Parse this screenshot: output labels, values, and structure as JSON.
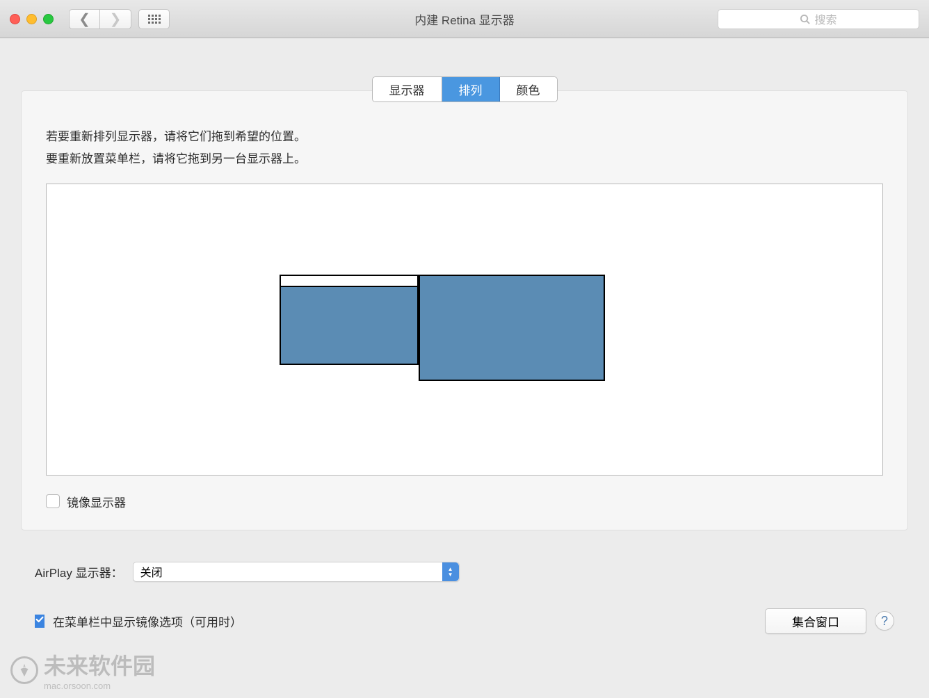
{
  "window": {
    "title": "内建 Retina 显示器"
  },
  "search": {
    "placeholder": "搜索"
  },
  "tabs": {
    "display": "显示器",
    "arrangement": "排列",
    "color": "颜色"
  },
  "instructions": {
    "line1": "若要重新排列显示器，请将它们拖到希望的位置。",
    "line2": "要重新放置菜单栏，请将它拖到另一台显示器上。"
  },
  "mirror": {
    "label": "镜像显示器"
  },
  "airplay": {
    "label": "AirPlay 显示器：",
    "selected": "关闭"
  },
  "footer": {
    "show_mirror_label": "在菜单栏中显示镜像选项（可用时）",
    "gather_windows": "集合窗口",
    "help": "?"
  },
  "watermark": {
    "text": "未来软件园",
    "url": "mac.orsoon.com"
  }
}
